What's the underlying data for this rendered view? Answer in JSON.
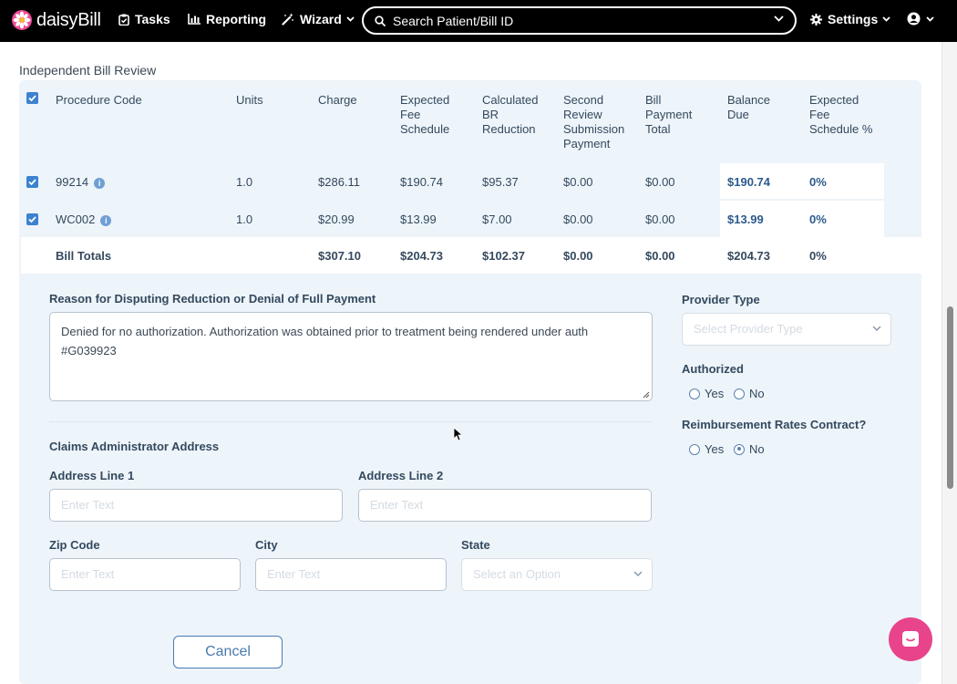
{
  "nav": {
    "brand": "daisyBill",
    "tasks": "Tasks",
    "reporting": "Reporting",
    "wizard": "Wizard",
    "search_placeholder": "Search Patient/Bill ID",
    "settings": "Settings"
  },
  "section_title": "Independent Bill Review",
  "table": {
    "headers": [
      [
        "Procedure Code"
      ],
      [
        "Units"
      ],
      [
        "Charge"
      ],
      [
        "Expected",
        "Fee",
        "Schedule"
      ],
      [
        "Calculated",
        "BR",
        "Reduction"
      ],
      [
        "Second",
        "Review",
        "Submission",
        "Payment"
      ],
      [
        "Bill",
        "Payment",
        "Total"
      ],
      [
        "Balance",
        "Due"
      ],
      [
        "Expected",
        "Fee",
        "Schedule %"
      ]
    ],
    "rows": [
      {
        "code": "99214",
        "units": "1.0",
        "charge": "$286.11",
        "expected": "$190.74",
        "br_reduction": "$95.37",
        "second_review": "$0.00",
        "bill_payment": "$0.00",
        "balance_due": "$190.74",
        "pct": "0%"
      },
      {
        "code": "WC002",
        "units": "1.0",
        "charge": "$20.99",
        "expected": "$13.99",
        "br_reduction": "$7.00",
        "second_review": "$0.00",
        "bill_payment": "$0.00",
        "balance_due": "$13.99",
        "pct": "0%"
      }
    ],
    "totals": {
      "label": "Bill Totals",
      "charge": "$307.10",
      "expected": "$204.73",
      "br_reduction": "$102.37",
      "second_review": "$0.00",
      "bill_payment": "$0.00",
      "balance_due": "$204.73",
      "pct": "0%"
    }
  },
  "form": {
    "reason_label": "Reason for Disputing Reduction or Denial of Full Payment",
    "reason_value": "Denied for no authorization. Authorization was obtained prior to treatment being rendered under auth #G039923",
    "provider_type_label": "Provider Type",
    "provider_type_placeholder": "Select Provider Type",
    "authorized_label": "Authorized",
    "yes": "Yes",
    "no": "No",
    "reimbursement_label": "Reimbursement Rates Contract?",
    "claims_admin_label": "Claims Administrator Address",
    "address1_label": "Address Line 1",
    "address2_label": "Address Line 2",
    "zip_label": "Zip Code",
    "city_label": "City",
    "state_label": "State",
    "text_placeholder": "Enter Text",
    "state_placeholder": "Select an Option",
    "cancel": "Cancel"
  }
}
